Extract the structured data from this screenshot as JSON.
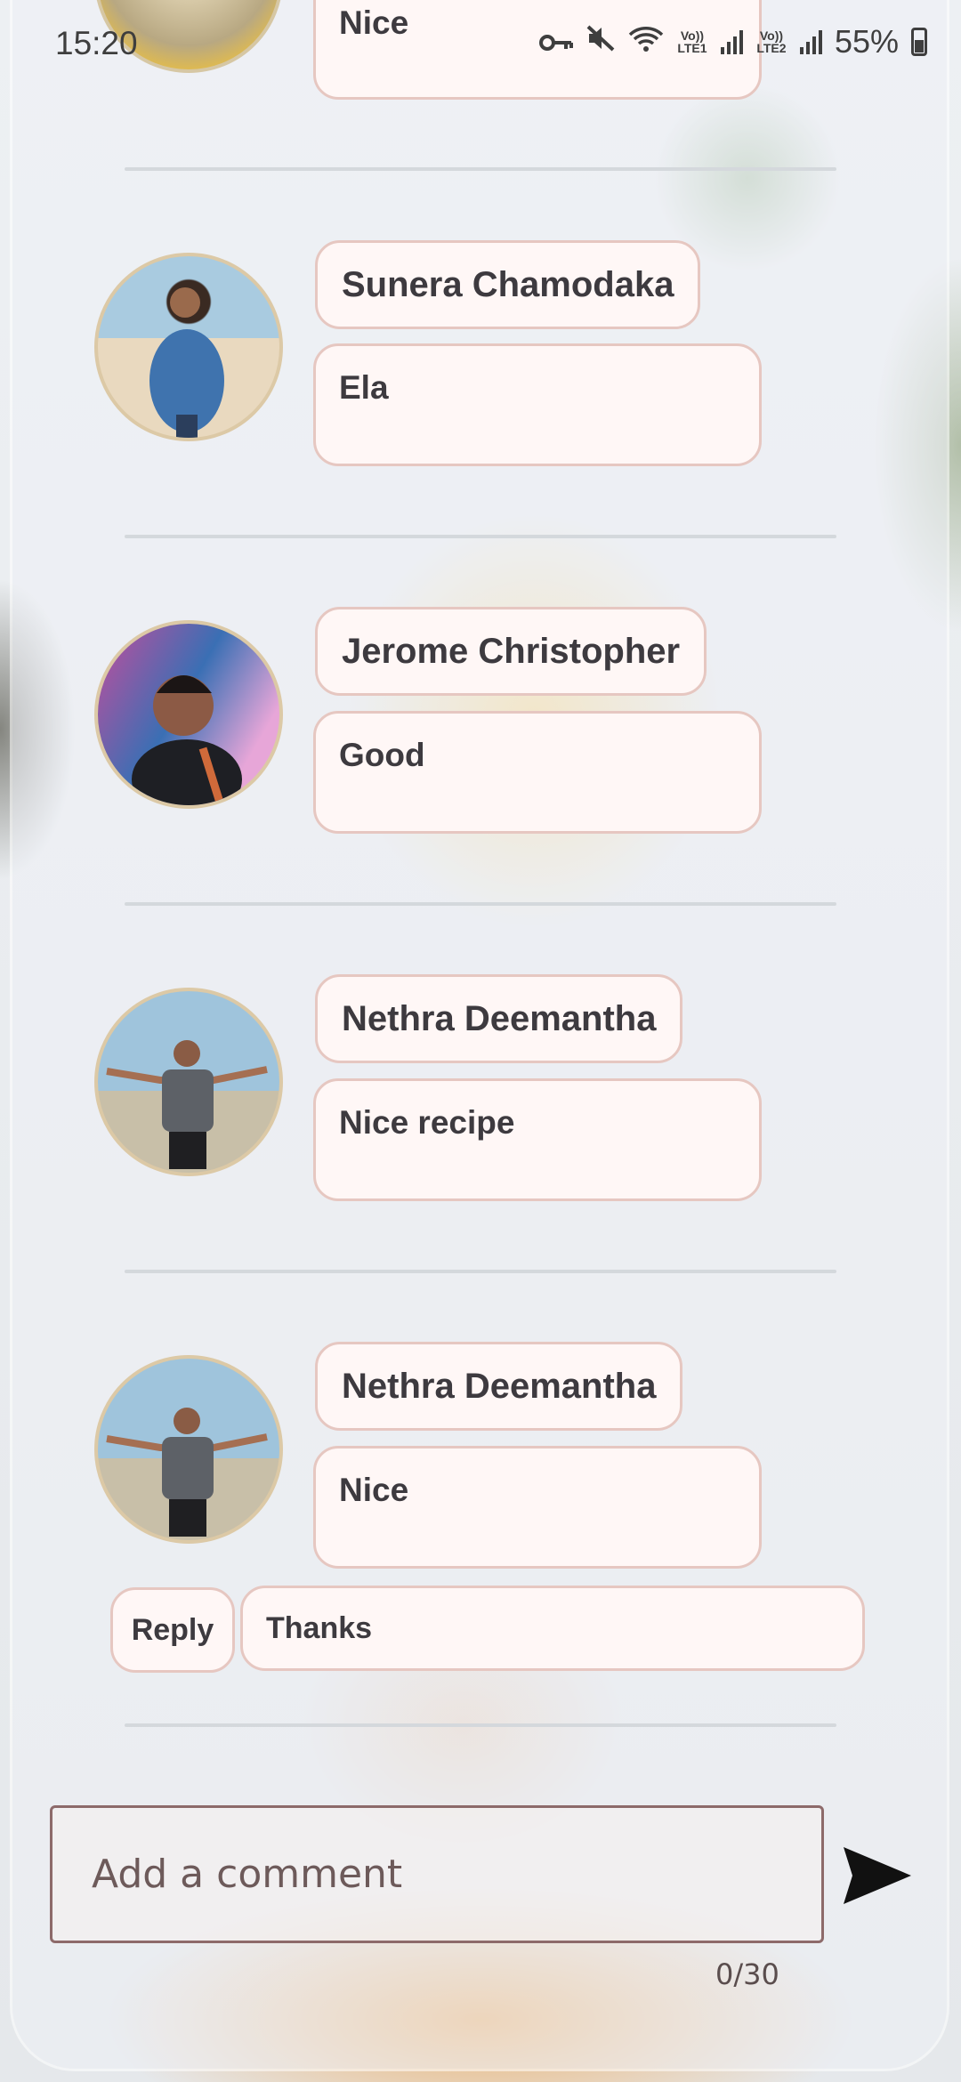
{
  "status_bar": {
    "time": "15:20",
    "battery": "55%",
    "sim1": "Vo)) LTE1",
    "sim2": "Vo)) LTE2"
  },
  "top_partial": {
    "text": "Nice"
  },
  "comments": [
    {
      "name": "Sunera Chamodaka",
      "text": "Ela"
    },
    {
      "name": "Jerome Christopher",
      "text": "Good"
    },
    {
      "name": "Nethra Deemantha",
      "text": "Nice recipe"
    },
    {
      "name": "Nethra Deemantha",
      "text": "Nice"
    }
  ],
  "reply": {
    "label": "Reply",
    "text": "Thanks"
  },
  "composer": {
    "placeholder": "Add a comment",
    "counter": "0/30"
  },
  "icons": [
    "key-icon",
    "mute-icon",
    "wifi-icon",
    "signal-icon",
    "battery-icon",
    "send-icon"
  ],
  "colors": {
    "pill_border": "#e6c7c1",
    "pill_fill": "#fff7f6",
    "avatar_ring": "#dcc9a6",
    "input_border": "#8d6a6a"
  }
}
